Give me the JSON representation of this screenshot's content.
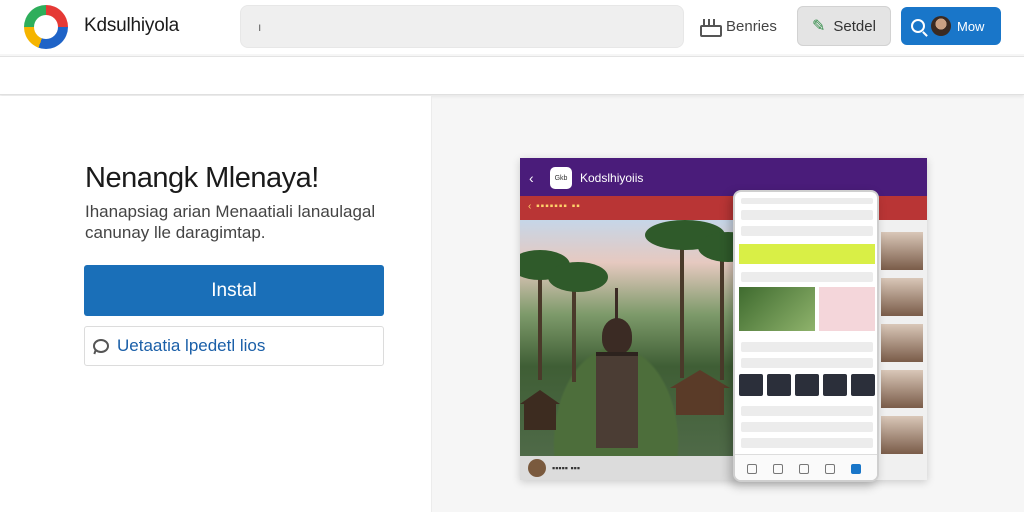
{
  "header": {
    "app_name": "Kdsulhiyola",
    "search_placeholder": "",
    "search_caret": "ı",
    "services_label": "Benries",
    "settings_label": "Setdel",
    "action_label": "Mow"
  },
  "hero": {
    "headline": "Nenangk Mlenaya!",
    "description": "Ihanapsiag arian Menaatiali lanaulagal canunay lle daragimtap.",
    "install_label": "Instal",
    "update_label": "Uetaatia lpedetl lios"
  },
  "preview": {
    "app_title": "Kodslhiyoiis",
    "app_icon_text": "Gkb"
  },
  "colors": {
    "primary": "#1a6fb8",
    "header_button": "#1976c9",
    "preview_top": "#4a1c7a",
    "preview_bar": "#b93535"
  },
  "icons": [
    "logo-icon",
    "services-icon",
    "leaf-icon",
    "search-icon",
    "avatar",
    "chat-icon",
    "back-arrow-icon"
  ]
}
